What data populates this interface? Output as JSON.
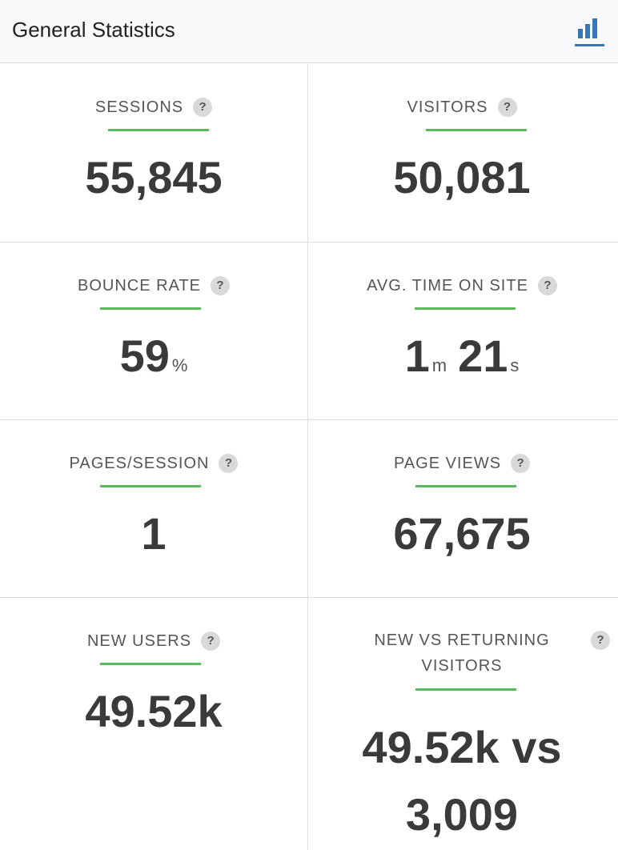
{
  "header": {
    "title": "General Statistics",
    "icon": "bar-chart-icon",
    "icon_color": "#3a78b5"
  },
  "help_glyph": "?",
  "accent_color": "#5cb85c",
  "stats": {
    "sessions": {
      "label": "SESSIONS",
      "value": "55,845"
    },
    "visitors": {
      "label": "VISITORS",
      "value": "50,081"
    },
    "bounce_rate": {
      "label": "BOUNCE RATE",
      "value": "59",
      "unit": "%"
    },
    "avg_time": {
      "label": "AVG. TIME ON SITE",
      "minutes": "1",
      "minutes_unit": "m",
      "seconds": "21",
      "seconds_unit": "s"
    },
    "pages_session": {
      "label": "PAGES/SESSION",
      "value": "1"
    },
    "page_views": {
      "label": "PAGE VIEWS",
      "value": "67,675"
    },
    "new_users": {
      "label": "NEW USERS",
      "value": "49.52k"
    },
    "new_vs_returning": {
      "label_line1": "NEW VS RETURNING",
      "label_line2": "VISITORS",
      "value_line1": "49.52k vs",
      "value_line2": "3,009"
    }
  }
}
